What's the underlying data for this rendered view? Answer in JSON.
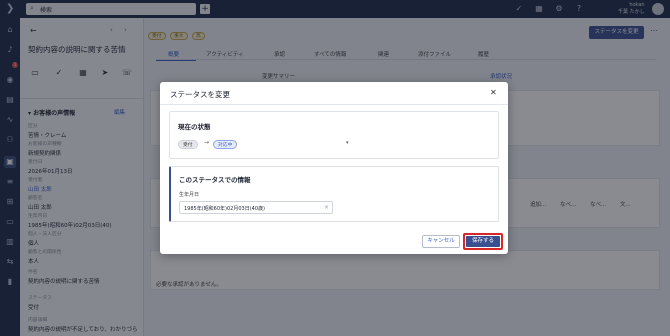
{
  "topbar": {
    "search_placeholder": "検索",
    "user_name": "hokan",
    "user_org": "千葉 たかし"
  },
  "leftpanel": {
    "title": "契約内容の説明に関する苦情",
    "section_title": "お客様の声情報",
    "edit_label": "編集",
    "fields": [
      {
        "label": "区分",
        "value": "苦情・クレーム"
      },
      {
        "label": "お客様の声種類",
        "value": "新規契約関係"
      },
      {
        "label": "受付日",
        "value": "2026年01月13日"
      },
      {
        "label": "受付者",
        "value": "山田 太郎"
      },
      {
        "label": "顧客名",
        "value": "山田 太郎"
      },
      {
        "label": "生年月日",
        "value": "1985年(昭和60年)02月03日(40)"
      },
      {
        "label": "個人・法人区分",
        "value": "個人"
      },
      {
        "label": "顧客との関係性",
        "value": "本人"
      },
      {
        "label": "件名",
        "value": "契約内容の説明に関する苦情"
      },
      {
        "label": "ステータス",
        "value": "受付"
      },
      {
        "label": "内容詳細",
        "value": "契約内容の説明が不足しており、わかりづら"
      }
    ]
  },
  "main": {
    "tags": [
      "受付",
      "重大",
      "高"
    ],
    "status_button": "ステータスを変更",
    "tabs": [
      "概要",
      "アクティビティ",
      "承認",
      "すべての情報",
      "関連",
      "添付ファイル",
      "履歴"
    ],
    "subtabs": [
      "変更サマリー",
      "承認状況"
    ],
    "columns": [
      "追加...",
      "なべ...",
      "なべ...",
      "文..."
    ],
    "empty_message": "必要な承認がありません。"
  },
  "modal": {
    "title": "ステータスを変更",
    "current_heading": "現在の状態",
    "from_status": "受付",
    "to_status": "対応中",
    "info_heading": "このステータスでの情報",
    "dob_label": "生年月日",
    "dob_value": "1985年(昭和60年)02月03日(40歳)",
    "cancel_label": "キャンセル",
    "save_label": "保存する"
  }
}
